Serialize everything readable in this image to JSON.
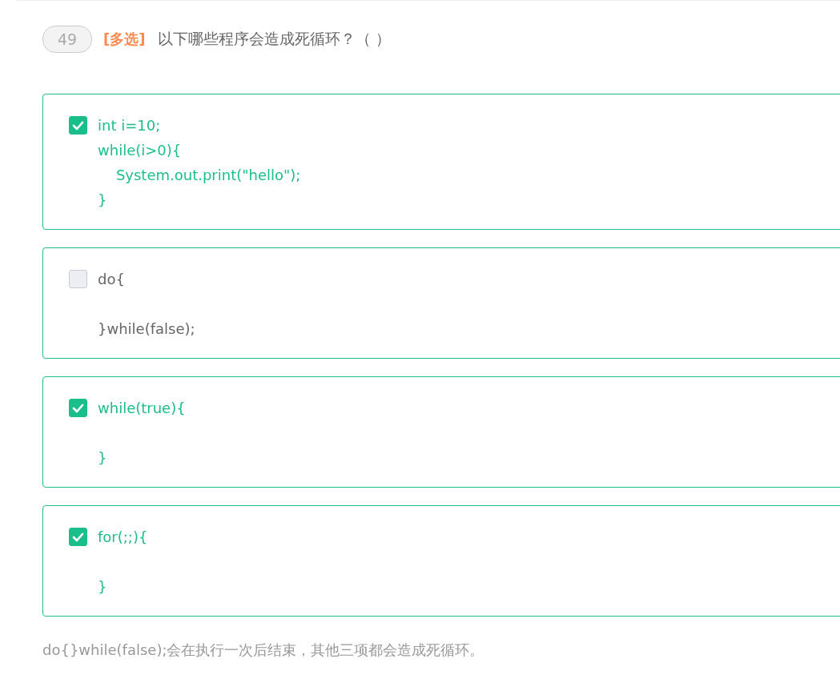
{
  "question": {
    "number": "49",
    "type_label": "[多选]",
    "text": "以下哪些程序会造成死循环？（ ）"
  },
  "options": [
    {
      "code": "int i=10;\nwhile(i>0){\n    System.out.print(\"hello\");\n}",
      "checked": true
    },
    {
      "code": "do{\n\n}while(false);",
      "checked": false
    },
    {
      "code": "while(true){\n\n}",
      "checked": true
    },
    {
      "code": "for(;;){\n\n}",
      "checked": true
    }
  ],
  "explanation": "do{}while(false);会在执行一次后结束，其他三项都会造成死循环。"
}
